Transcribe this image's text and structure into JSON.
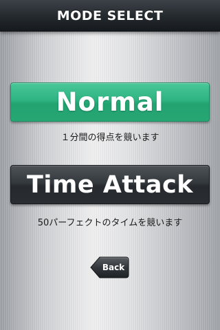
{
  "header": {
    "title": "MODE SELECT"
  },
  "modes": {
    "normal": {
      "label": "Normal",
      "description": "１分間の得点を競います"
    },
    "time_attack": {
      "label": "Time Attack",
      "description": "50パーフェクトのタイムを競います"
    }
  },
  "navigation": {
    "back_label": "Back"
  },
  "colors": {
    "normal_accent": "#2fb381",
    "time_attack_accent": "#2e3236",
    "header_background": "#1f2428"
  }
}
